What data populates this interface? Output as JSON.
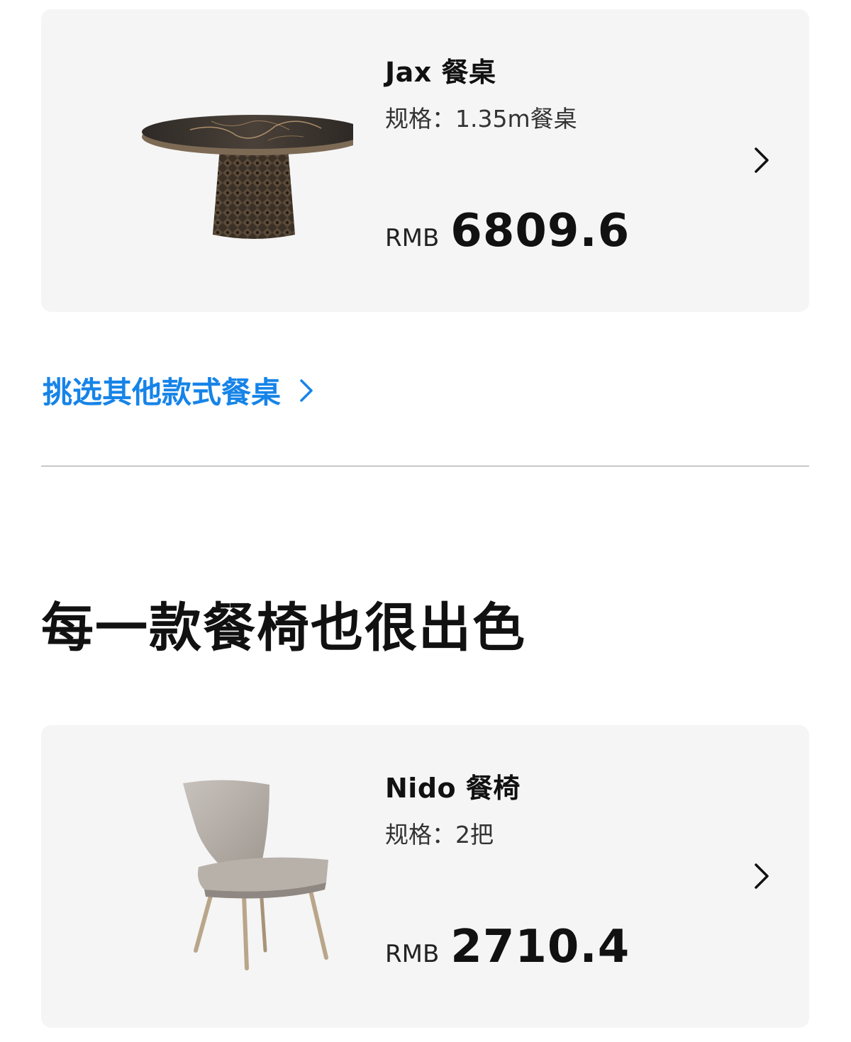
{
  "table_card": {
    "name": "Jax 餐桌",
    "spec": "规格：1.35m餐桌",
    "currency": "RMB",
    "price": "6809.6"
  },
  "more_tables_link": {
    "label": "挑选其他款式餐桌"
  },
  "chairs_section": {
    "title": "每一款餐椅也很出色"
  },
  "chair_card": {
    "name": "Nido 餐椅",
    "spec": "规格：2把",
    "currency": "RMB",
    "price": "2710.4"
  },
  "icons": {
    "card_chevron": "chevron-right-icon",
    "link_chevron": "chevron-right-icon"
  },
  "colors": {
    "accent_link": "#1684e8",
    "card_background": "#f5f5f5"
  }
}
